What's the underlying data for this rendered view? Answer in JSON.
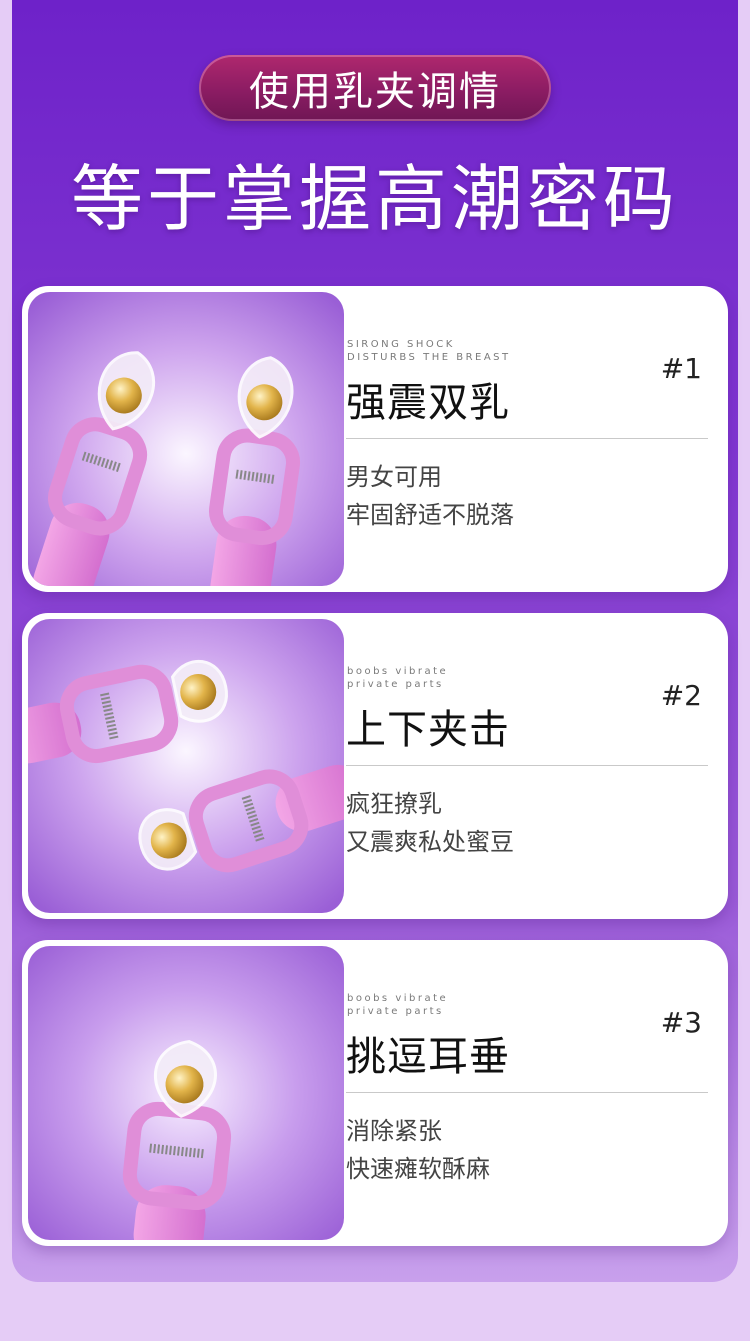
{
  "header": {
    "badge": "使用乳夹调情",
    "headline": "等于掌握高潮密码"
  },
  "features": [
    {
      "sub_line1": "SIRONG SHOCK",
      "sub_line2": "DISTURBS THE BREAST",
      "number": "#1",
      "title": "强震双乳",
      "desc_line1": "男女可用",
      "desc_line2": "牢固舒适不脱落"
    },
    {
      "sub_line1": "boobs vibrate",
      "sub_line2": "private parts",
      "number": "#2",
      "title": "上下夹击",
      "desc_line1": "疯狂撩乳",
      "desc_line2": "又震爽私处蜜豆"
    },
    {
      "sub_line1": "boobs vibrate",
      "sub_line2": "private parts",
      "number": "#3",
      "title": "挑逗耳垂",
      "desc_line1": "消除紧张",
      "desc_line2": "快速瘫软酥麻"
    }
  ]
}
